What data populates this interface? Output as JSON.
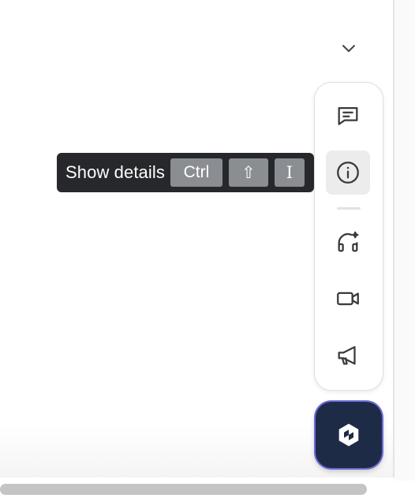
{
  "tooltip": {
    "label": "Show details",
    "keys": {
      "ctrl": "Ctrl",
      "shift": "⇧",
      "i": "I"
    }
  },
  "toolbar": {
    "items": [
      {
        "icon": "comment-icon",
        "active": false
      },
      {
        "icon": "info-icon",
        "active": true
      },
      {
        "icon": "headset-sparkle-icon",
        "active": false
      },
      {
        "icon": "video-camera-icon",
        "active": false
      },
      {
        "icon": "megaphone-icon",
        "active": false
      }
    ]
  },
  "fab": {
    "icon": "app-logo-icon"
  },
  "colors": {
    "tooltip_bg": "#26282c",
    "key_bg": "#8a8d92",
    "fab_bg": "#1e2b47",
    "active_bg": "#ececec"
  }
}
